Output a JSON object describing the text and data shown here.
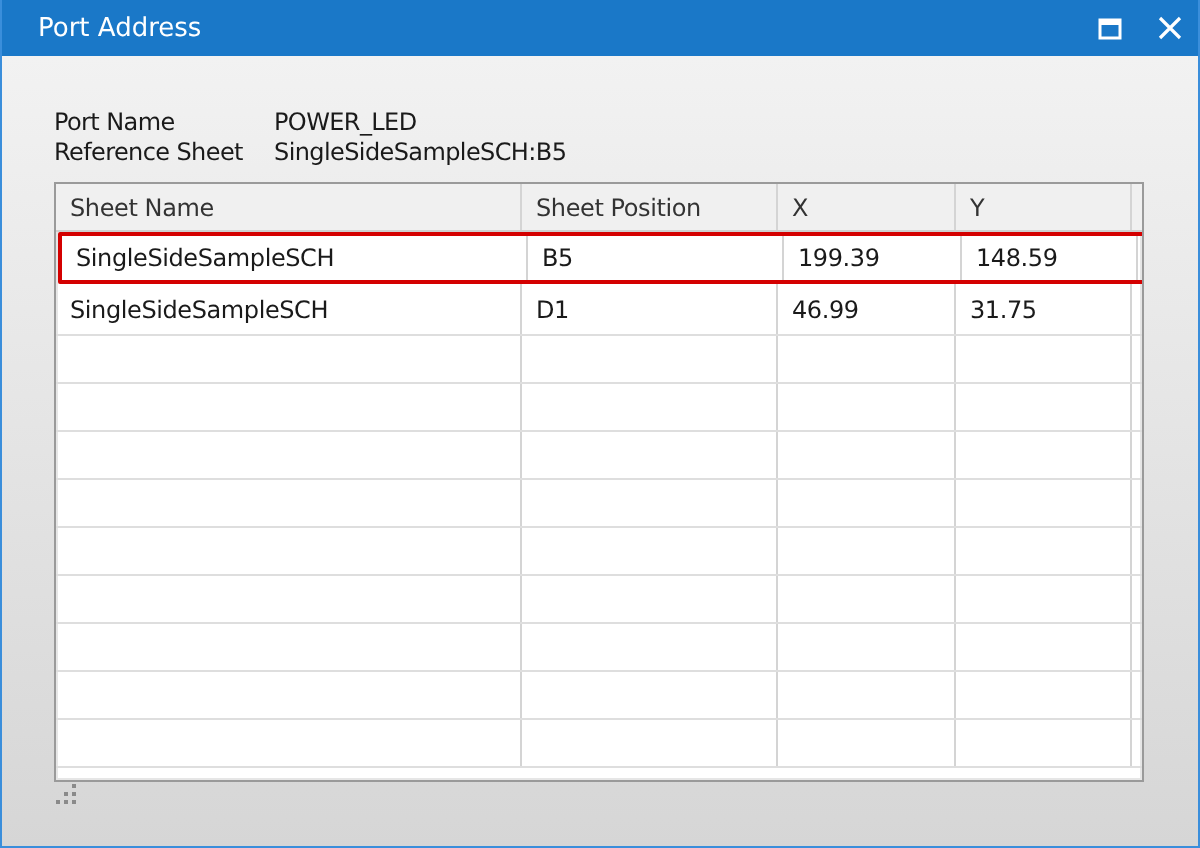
{
  "window": {
    "title": "Port Address"
  },
  "fields": [
    {
      "label": "Port Name",
      "value": "POWER_LED"
    },
    {
      "label": "Reference Sheet",
      "value": "SingleSideSampleSCH:B5"
    }
  ],
  "table": {
    "columns": [
      "Sheet Name",
      "Sheet Position",
      "X",
      "Y"
    ],
    "rows": [
      {
        "cells": [
          "SingleSideSampleSCH",
          "B5",
          "199.39",
          "148.59"
        ],
        "selected": true
      },
      {
        "cells": [
          "SingleSideSampleSCH",
          "D1",
          "46.99",
          "31.75"
        ],
        "selected": false
      }
    ]
  }
}
